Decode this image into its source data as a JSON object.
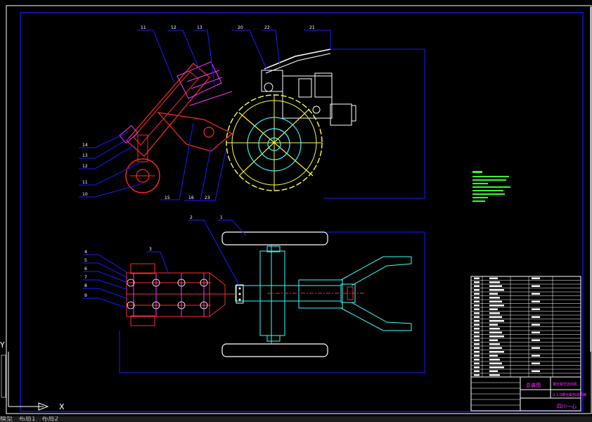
{
  "drawing": {
    "colors": {
      "background": "#000000",
      "frame": "#1a1aff",
      "part_red": "#ff2a2a",
      "part_magenta": "#ff33ff",
      "part_yellow": "#ffff40",
      "part_cyan": "#33ffff",
      "part_white": "#ffffff",
      "notes_green": "#33ff33"
    },
    "balloons_top": [
      "11",
      "12",
      "13",
      "20",
      "22",
      "21",
      "14",
      "13",
      "12",
      "11",
      "10",
      "15",
      "16",
      "23"
    ],
    "balloons_bottom": [
      "2",
      "1",
      "3",
      "4",
      "5",
      "6",
      "7",
      "8",
      "9"
    ],
    "title_block": {
      "drawing_name": "总装图",
      "subtitle_1": "钢丝钳式自动机",
      "subtitle_2": "0-1-0钢丝钳自动机械",
      "company": "四川一心"
    }
  },
  "axes_icon": {
    "x_label": "X",
    "y_label": "Y"
  },
  "layout_tabs": [
    "模型",
    "布局1",
    "布局2"
  ]
}
